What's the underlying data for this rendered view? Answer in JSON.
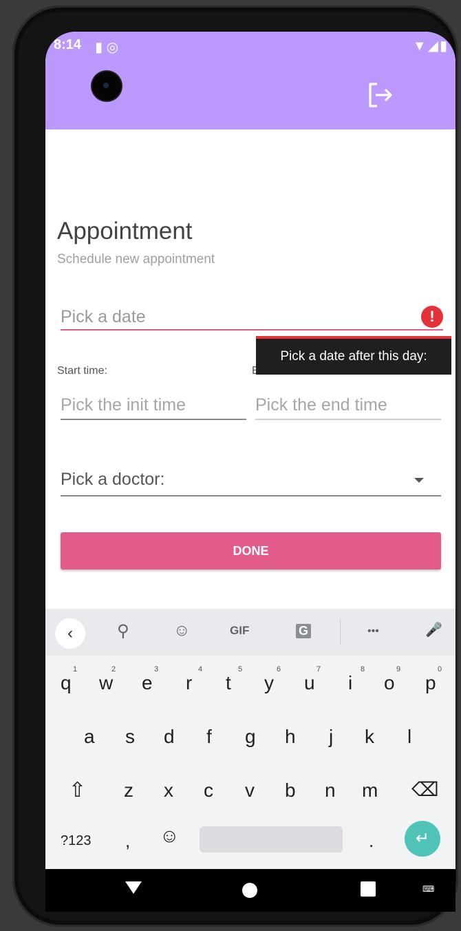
{
  "status_bar": {
    "time": "8:14",
    "left_icons": "▮ ◎",
    "right_icons": "▼◢▮"
  },
  "app_bar": {
    "logout_icon": "logout-icon",
    "color": "#bb99ff"
  },
  "form": {
    "title": "Appointment",
    "subtitle": "Schedule new appointment",
    "date_field": {
      "placeholder": "Pick a date",
      "error_icon": "!",
      "error_tooltip": "Pick a date after this day:"
    },
    "start_time_label": "Start time:",
    "end_time_label": "End time:",
    "start_time_placeholder": "Pick the init time",
    "end_time_placeholder": "Pick the end time",
    "doctor_label": "Pick a doctor:",
    "done_button": "DONE",
    "accent_color": "#e35b8a",
    "error_color": "#e53238"
  },
  "keyboard": {
    "toolbar": {
      "back": "‹",
      "search": "⚲",
      "sticker": "☺",
      "gif": "GIF",
      "translate": "G",
      "more": "•••",
      "mic": "🎤"
    },
    "row1": [
      {
        "key": "q",
        "num": "1"
      },
      {
        "key": "w",
        "num": "2"
      },
      {
        "key": "e",
        "num": "3"
      },
      {
        "key": "r",
        "num": "4"
      },
      {
        "key": "t",
        "num": "5"
      },
      {
        "key": "y",
        "num": "6"
      },
      {
        "key": "u",
        "num": "7"
      },
      {
        "key": "i",
        "num": "8"
      },
      {
        "key": "o",
        "num": "9"
      },
      {
        "key": "p",
        "num": "0"
      }
    ],
    "row2": [
      "a",
      "s",
      "d",
      "f",
      "g",
      "h",
      "j",
      "k",
      "l"
    ],
    "row3": [
      "z",
      "x",
      "c",
      "v",
      "b",
      "n",
      "m"
    ],
    "shift": "⇧",
    "backspace": "⌫",
    "symbols": "?123",
    "comma": ",",
    "emoji": "☺",
    "period": ".",
    "enter": "↵",
    "enter_color": "#4fc3b8"
  },
  "nav_bar": {
    "keyboard_switch": "⌨"
  }
}
